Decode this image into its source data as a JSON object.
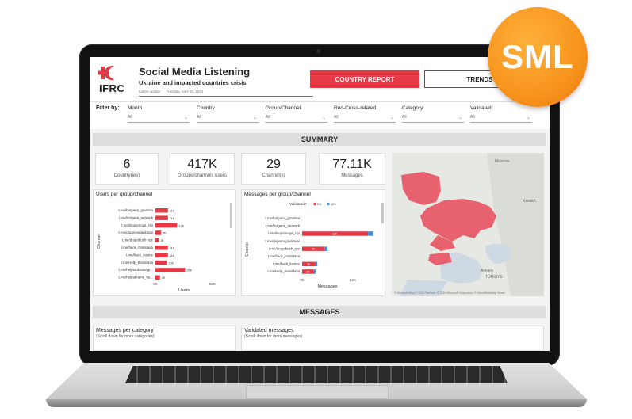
{
  "badge": {
    "text": "SML",
    "color": "#f7941d"
  },
  "header": {
    "logo_text": "IFRC",
    "title": "Social Media Listening",
    "subtitle": "Ukraine and impacted countries crisis",
    "latest_update_label": "Latest update:",
    "latest_update_value": "Tuesday, April 09, 2024",
    "country_report_button": "COUNTRY REPORT",
    "trends_button": "TRENDS"
  },
  "filters": {
    "label": "Filter by:",
    "items": [
      {
        "label": "Month",
        "value": "All"
      },
      {
        "label": "Country",
        "value": "All"
      },
      {
        "label": "Group/Channel",
        "value": "All"
      },
      {
        "label": "Red-Cross-related",
        "value": "All"
      },
      {
        "label": "Category",
        "value": "All"
      },
      {
        "label": "Validated",
        "value": "All"
      }
    ]
  },
  "summary": {
    "title": "SUMMARY",
    "kpis": [
      {
        "value": "6",
        "label": "Country(ies)"
      },
      {
        "value": "417K",
        "label": "Groups/channels users"
      },
      {
        "value": "29",
        "label": "Channel(s)"
      },
      {
        "value": "77.11K",
        "label": "Messages"
      }
    ]
  },
  "messages_section": {
    "title": "MESSAGES",
    "per_category_title": "Messages per category",
    "per_category_hint": "(Scroll down for more categories)",
    "validated_title": "Validated messages",
    "validated_hint": "(Scroll down for more messages)"
  },
  "map": {
    "note": "© Microsoft Bing  © 2024 TomTom, © 2024 Microsoft Corporation  © OpenStreetMap  Terms",
    "labels": [
      "Moscow",
      "Kazakh.",
      "Ankara",
      "TÜRKIYE"
    ],
    "highlight_color": "#e8616f"
  },
  "colors": {
    "accent": "#e63946",
    "no": "#e63946",
    "yes": "#3b8ed8"
  },
  "chart_data": [
    {
      "type": "bar",
      "title": "Users per group/channel",
      "xlabel": "Users",
      "ylabel": "Channel",
      "categories": [
        "t.me/bulgaria_granitsa",
        "t.me/bulgaria_network",
        "t.me/Dopomoga_rzp",
        "t.me/dopomogaukraini",
        "t.me/drogobuch_rpc",
        "t.me/hack_bratislava",
        "t.me/hack_kosice",
        "t.me/Help_Bratislava",
        "t.me/helptoukrainegr...",
        "t.me/helpukraine_hu..."
      ],
      "values": [
        11000,
        11000,
        19000,
        5000,
        3000,
        11000,
        11000,
        10000,
        26000,
        4000
      ],
      "data_labels": [
        "11K",
        "11K",
        "19K",
        "5K",
        "3K",
        "11K",
        "11K",
        "10K",
        "26K",
        "4K"
      ],
      "xlim": [
        0,
        50000
      ],
      "x_ticks": [
        "0K",
        "50K"
      ]
    },
    {
      "type": "bar",
      "title": "Messages per group/channel",
      "xlabel": "Messages",
      "ylabel": "Channel",
      "legend_title": "Validated?",
      "legend": [
        "no",
        "yes"
      ],
      "categories": [
        "t.me/bulgaria_granitsa",
        "t.me/bulgaria_network",
        "t.me/Dopomoga_rzp",
        "t.me/dopomogaukraini",
        "t.me/drogobuch_rpc",
        "t.me/hack_bratislava",
        "t.me/hack_kosice",
        "t.me/Help_Bratislava"
      ],
      "series": [
        {
          "name": "no",
          "values": [
            0,
            0,
            13000,
            0,
            4500,
            0,
            2600,
            2300
          ]
        },
        {
          "name": "yes",
          "values": [
            0,
            0,
            1000,
            0,
            500,
            0,
            400,
            350
          ]
        }
      ],
      "data_labels": [
        "",
        "",
        "13K",
        "",
        "5K",
        "",
        "3K",
        "3K"
      ],
      "xlim": [
        0,
        10000
      ],
      "x_ticks": [
        "0K",
        "10K"
      ]
    }
  ]
}
